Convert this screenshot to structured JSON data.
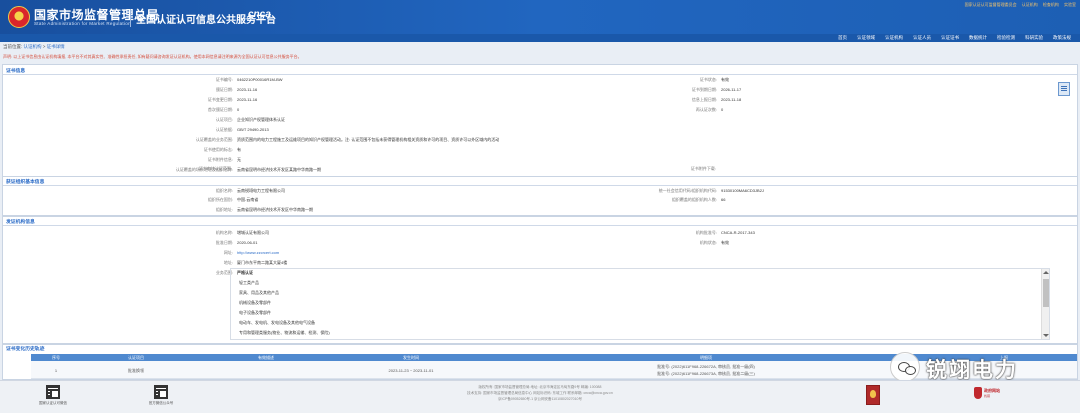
{
  "header": {
    "org_name": "国家市场监督管理总局",
    "org_name_en": "State Administration for Market Regulation",
    "platform": "全国认证认可信息公共服务平台",
    "logo_text": "cnca",
    "top_links": [
      "国家认证认可监督管理委员会",
      "认证机构",
      "检查机构",
      "实验室"
    ]
  },
  "nav": [
    "首页",
    "认证领域",
    "认证机构",
    "认证人员",
    "认证证书",
    "数据统计",
    "检验检测",
    "科研实验",
    "政策法规"
  ],
  "breadcrumb": {
    "prefix": "当前位置:",
    "item1": "认证机构",
    "sep": " > ",
    "item2": "证书详情"
  },
  "notice": "声明: 以上证书信息由认证机构填报, 本平台不对其真实性、准确性承担责任, 如有疑问请咨询发证认证机构。使用本网信息请注明来源为全国认证认可信息公共服务平台。",
  "cert": {
    "title": "证书信息",
    "rows": [
      {
        "label": "证书编号:",
        "value": "0462210P00016R1M-BW",
        "label2": "证书状态:",
        "value2": "有效"
      },
      {
        "label": "颁证日期:",
        "value": "2023-11-16",
        "label2": "证书到期日期:",
        "value2": "2026-11-17"
      },
      {
        "label": "证书变更日期:",
        "value": "2023-11-16",
        "label2": "信息上报日期:",
        "value2": "2023-11-18"
      },
      {
        "label": "首次颁证日期:",
        "value": "0",
        "label2": "再认证次数:",
        "value2": "0"
      },
      {
        "label": "认证项目:",
        "value": "企业知识产权管理体系认证"
      },
      {
        "label": "认证依据:",
        "value": "GB/T 29490-2013"
      },
      {
        "label": "认证覆盖的业务范围:",
        "value": "资质范围内的电力工程施工及运维项目的知识产权管理活动。注: 认证范围不包括未获得管理机构相关资质和许可的项目、资质许可以外区域内的活动"
      },
      {
        "label": "证书使用的标志:",
        "value": "有"
      },
      {
        "label": "证书附件信息:",
        "value": "无"
      },
      {
        "label": "认证覆盖的场所地址及组织名称:",
        "value": "云南省昆明市经济技术开发区某路中华南路一期"
      },
      {
        "label": "证书审核认证范围:",
        "value": "",
        "label2": "证书附件下载:",
        "value2": ""
      }
    ]
  },
  "org": {
    "title": "获证组织基本信息",
    "rows": [
      {
        "label": "组织名称:",
        "value": "云南锐翊电力工程有限公司",
        "label2": "统一社会信用代码/组织机构代码:",
        "value2": "91530100MA6CD3JB2J"
      },
      {
        "label": "组织所在国别:",
        "value": "中国-云南省",
        "label2": "组织覆盖的组织机构人数:",
        "value2": "66"
      },
      {
        "label": "组织地址:",
        "value": "云南省昆明市经济技术开发区中华南路一期"
      }
    ]
  },
  "agency": {
    "title": "发证机构信息",
    "rows": [
      {
        "label": "机构名称:",
        "value": "增城认证有限公司",
        "label2": "机构批准号:",
        "value2": "CNCA-R-2017-343"
      },
      {
        "label": "批准日期:",
        "value": "2020-06-01",
        "label2": "机构状态:",
        "value2": "有效"
      },
      {
        "label": "网址:",
        "value": "http://www.zzcrcert.com"
      },
      {
        "label": "地址:",
        "value": "厦门市东平南二路某大厦4楼"
      },
      {
        "label": "业务范围:",
        "value": "严格认证"
      }
    ],
    "scope_items": [
      "轻工类产品",
      "家具、用品及其他产品",
      "机械设备及零部件",
      "电子设备及零部件",
      "电动车、发电机、发电设备及其他电气设备",
      "专用和管理类服务(物业、物流和运输、检测、保险)"
    ]
  },
  "table": {
    "title": "证书变化历史轨迹",
    "headers": [
      "序号",
      "认证项目",
      "有效描述",
      "发生时间",
      "明细项",
      "上报"
    ],
    "row": {
      "no": "1",
      "item": "批准换领",
      "desc": "",
      "time": "2023-11-23 ~ 2023-11-01",
      "detail1": "批准号: (2022)611F968-226672A, 审核员, 批准一级(四)",
      "detail2": "批准号: (2022)611F968-226673A, 审核员, 批准二级(三)"
    }
  },
  "footer": {
    "qr1": "国家认证认可微信",
    "qr2": "官方微信公众号",
    "line1": "版权所有: 国家市场监督管理总局 地址: 北京市海淀区马甸东路9号 邮编: 100088",
    "line2": "技术支持: 国家市场监督管理总局信息中心 网站标识码: 东城工作 联系邮箱: cnca@cnca.gov.cn",
    "line3": "京ICP备09052650号-1 京公网安备11010802027010号",
    "badge2_line1": "政府网站",
    "badge2_line2": "找错"
  },
  "watermark": "锐翊电力"
}
